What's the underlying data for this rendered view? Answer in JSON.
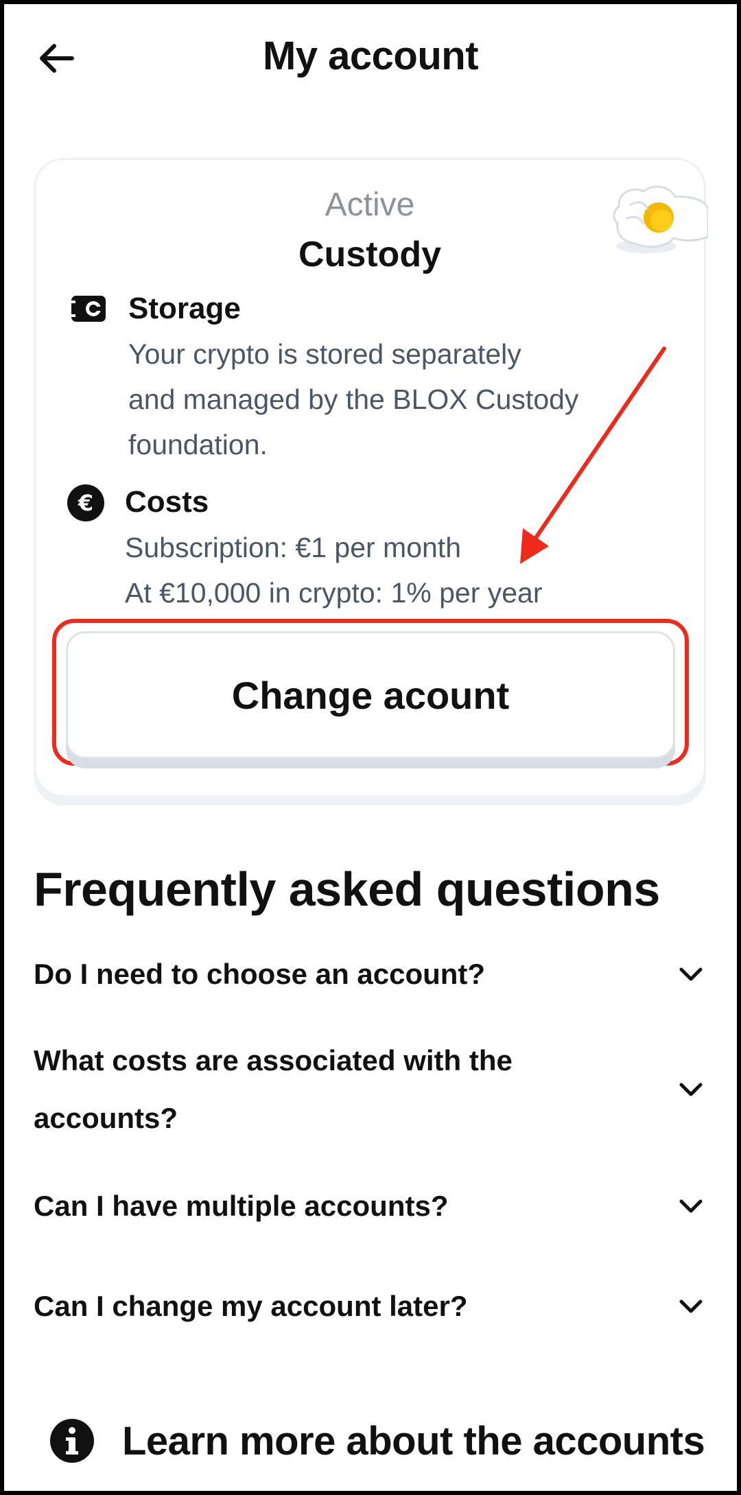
{
  "header": {
    "title": "My account",
    "back_icon": "arrow-left-icon"
  },
  "account_card": {
    "status": "Active",
    "type": "Custody",
    "storage": {
      "icon": "wallet-icon",
      "title": "Storage",
      "lines": [
        "Your crypto is stored separately",
        "and managed by the BLOX Custody",
        "foundation."
      ]
    },
    "costs": {
      "icon": "euro-icon",
      "title": "Costs",
      "lines": [
        "Subscription: €1 per month",
        "At €10,000 in crypto: 1% per year"
      ]
    },
    "change_button_label": "Change acount"
  },
  "annotation": {
    "color": "#ef2a1a"
  },
  "faq": {
    "title": "Frequently asked questions",
    "items": [
      {
        "question": "Do I need to choose an account?"
      },
      {
        "question": "What costs are associated with the accounts?"
      },
      {
        "question": "Can I have multiple accounts?"
      },
      {
        "question": "Can I change my account later?"
      }
    ]
  },
  "learn_more": {
    "icon": "info-icon",
    "label": "Learn more about the accounts"
  }
}
